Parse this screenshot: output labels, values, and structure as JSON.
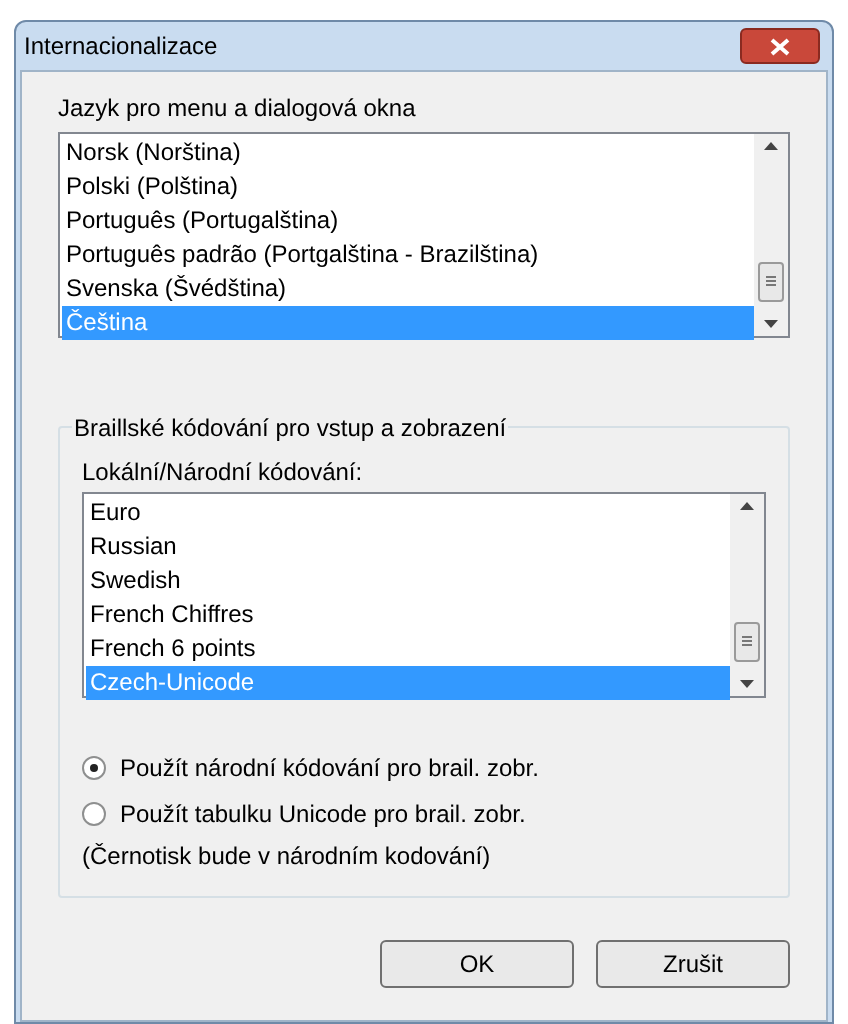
{
  "window": {
    "title": "Internacionalizace"
  },
  "language": {
    "label": "Jazyk pro menu a dialogová okna",
    "items": [
      {
        "label": "Norsk (Norština)",
        "selected": false
      },
      {
        "label": "Polski (Polština)",
        "selected": false
      },
      {
        "label": "Português (Portugalština)",
        "selected": false
      },
      {
        "label": "Português padrão (Portgalština - Brazilština)",
        "selected": false
      },
      {
        "label": "Svenska (Švédština)",
        "selected": false
      },
      {
        "label": "Čeština",
        "selected": true
      }
    ]
  },
  "braille": {
    "legend": "Braillské kódování pro vstup a zobrazení",
    "label": "Lokální/Národní kódování:",
    "items": [
      {
        "label": "Euro",
        "selected": false
      },
      {
        "label": "Russian",
        "selected": false
      },
      {
        "label": "Swedish",
        "selected": false
      },
      {
        "label": "French Chiffres",
        "selected": false
      },
      {
        "label": "French 6 points",
        "selected": false
      },
      {
        "label": "Czech-Unicode",
        "selected": true
      }
    ],
    "options": [
      {
        "label": "Použít národní kódování pro brail. zobr.",
        "selected": true
      },
      {
        "label": "Použít tabulku Unicode pro brail. zobr.",
        "selected": false
      }
    ],
    "note": "(Černotisk bude v národním kodování)"
  },
  "buttons": [
    "OK",
    "Zrušit"
  ]
}
